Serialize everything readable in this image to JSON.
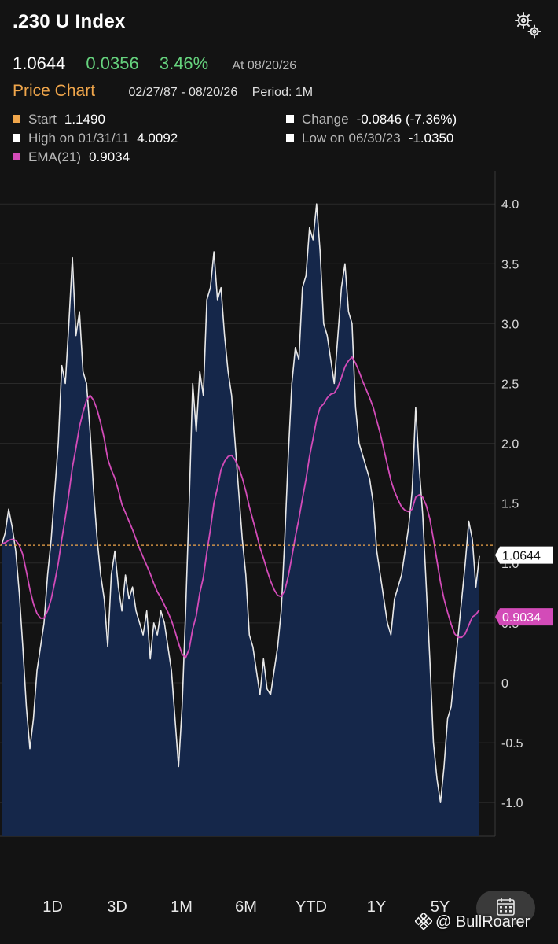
{
  "header": {
    "title": ".230 U Index",
    "last": "1.0644",
    "change": "0.0356",
    "change_pct": "3.46%",
    "as_of": "At 08/20/26",
    "settings_icon": "gears-icon"
  },
  "price_chart": {
    "title": "Price Chart",
    "range": "02/27/87 - 08/20/26",
    "period": "Period: 1M"
  },
  "stats": {
    "start": {
      "label": "Start",
      "value": "1.1490"
    },
    "change": {
      "label": "Change",
      "value": "-0.0846 (-7.36%)"
    },
    "high": {
      "label": "High on 01/31/11",
      "value": "4.0092"
    },
    "low": {
      "label": "Low on 06/30/23",
      "value": "-1.0350"
    },
    "ema": {
      "label": "EMA(21)",
      "value": "0.9034"
    }
  },
  "colors": {
    "background": "#131313",
    "price_line": "#e8e8e8",
    "area_fill": "#15274a",
    "ema": "#d34bb8",
    "start_line": "#f0a64b",
    "positive": "#66d37e"
  },
  "chart_data": {
    "type": "area",
    "x_range": [
      "02/27/87",
      "08/20/26"
    ],
    "ylim": [
      -1.3,
      4.1
    ],
    "y_ticks": [
      "4.0",
      "3.5",
      "3.0",
      "2.5",
      "2.0",
      "1.5",
      "1.0",
      "0.5",
      "0",
      "-0.5",
      "-1.0"
    ],
    "y_tick_values": [
      4.0,
      3.5,
      3.0,
      2.5,
      2.0,
      1.5,
      1.0,
      0.5,
      0,
      -0.5,
      -1.0
    ],
    "grid": true,
    "reference_line": {
      "name": "Start",
      "value": 1.149
    },
    "last_value_tag": "1.0644",
    "ema_value_tag": "0.9034",
    "series": [
      {
        "name": "Price",
        "values": [
          1.15,
          1.25,
          1.45,
          1.3,
          1.1,
          0.75,
          0.3,
          -0.2,
          -0.55,
          -0.3,
          0.1,
          0.3,
          0.5,
          0.9,
          1.2,
          1.6,
          2.0,
          2.65,
          2.5,
          3.0,
          3.55,
          2.9,
          3.1,
          2.6,
          2.5,
          2.1,
          1.6,
          1.2,
          0.9,
          0.7,
          0.3,
          0.9,
          1.1,
          0.8,
          0.6,
          0.9,
          0.7,
          0.8,
          0.6,
          0.5,
          0.4,
          0.6,
          0.2,
          0.5,
          0.4,
          0.6,
          0.5,
          0.3,
          0.1,
          -0.3,
          -0.7,
          -0.2,
          0.6,
          1.5,
          2.5,
          2.1,
          2.6,
          2.4,
          3.2,
          3.3,
          3.6,
          3.2,
          3.3,
          2.9,
          2.6,
          2.4,
          2.0,
          1.6,
          1.2,
          0.9,
          0.4,
          0.3,
          0.1,
          -0.1,
          0.2,
          -0.05,
          -0.1,
          0.1,
          0.3,
          0.6,
          1.2,
          1.9,
          2.5,
          2.8,
          2.7,
          3.3,
          3.4,
          3.8,
          3.7,
          4.0,
          3.6,
          3.0,
          2.9,
          2.7,
          2.5,
          2.9,
          3.3,
          3.5,
          3.1,
          3.0,
          2.3,
          2.0,
          1.9,
          1.8,
          1.7,
          1.5,
          1.1,
          0.9,
          0.7,
          0.5,
          0.4,
          0.7,
          0.8,
          0.9,
          1.1,
          1.3,
          1.6,
          2.3,
          1.8,
          1.4,
          0.8,
          0.2,
          -0.5,
          -0.8,
          -1.0,
          -0.7,
          -0.3,
          -0.2,
          0.1,
          0.4,
          0.7,
          1.0,
          1.35,
          1.2,
          0.8,
          1.06
        ]
      },
      {
        "name": "EMA(21)",
        "values": [
          1.16,
          1.17,
          1.19,
          1.2,
          1.19,
          1.15,
          1.07,
          0.93,
          0.78,
          0.66,
          0.58,
          0.54,
          0.54,
          0.6,
          0.7,
          0.84,
          1.0,
          1.2,
          1.38,
          1.58,
          1.8,
          1.96,
          2.14,
          2.26,
          2.36,
          2.4,
          2.36,
          2.28,
          2.17,
          2.04,
          1.87,
          1.78,
          1.71,
          1.61,
          1.49,
          1.42,
          1.35,
          1.28,
          1.2,
          1.12,
          1.05,
          0.98,
          0.91,
          0.83,
          0.76,
          0.71,
          0.65,
          0.59,
          0.52,
          0.43,
          0.33,
          0.24,
          0.21,
          0.28,
          0.45,
          0.56,
          0.75,
          0.88,
          1.09,
          1.28,
          1.5,
          1.63,
          1.78,
          1.85,
          1.89,
          1.9,
          1.86,
          1.8,
          1.71,
          1.6,
          1.47,
          1.36,
          1.25,
          1.13,
          1.04,
          0.94,
          0.85,
          0.78,
          0.73,
          0.72,
          0.77,
          0.89,
          1.05,
          1.22,
          1.37,
          1.54,
          1.7,
          1.89,
          2.04,
          2.2,
          2.3,
          2.33,
          2.38,
          2.41,
          2.42,
          2.47,
          2.55,
          2.64,
          2.69,
          2.72,
          2.67,
          2.6,
          2.52,
          2.45,
          2.38,
          2.3,
          2.19,
          2.08,
          1.95,
          1.82,
          1.69,
          1.6,
          1.53,
          1.47,
          1.44,
          1.43,
          1.45,
          1.55,
          1.57,
          1.55,
          1.48,
          1.37,
          1.2,
          1.02,
          0.84,
          0.7,
          0.59,
          0.49,
          0.41,
          0.38,
          0.38,
          0.41,
          0.48,
          0.55,
          0.57,
          0.61
        ]
      }
    ]
  },
  "periods": [
    "1D",
    "3D",
    "1M",
    "6M",
    "YTD",
    "1Y",
    "5Y"
  ],
  "calendar_icon": "calendar-icon",
  "watermark": {
    "logo": "binance-logo",
    "text": "@ BullRoarer"
  }
}
